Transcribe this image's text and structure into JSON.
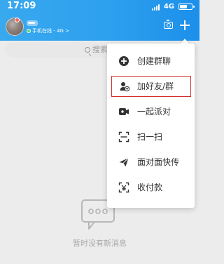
{
  "status_bar": {
    "time": "17:09",
    "network": "4G"
  },
  "header": {
    "online_status": "手机在线 - 4G >"
  },
  "search": {
    "placeholder": "搜索"
  },
  "menu": {
    "items": [
      {
        "label": "创建群聊",
        "icon": "group-chat-icon"
      },
      {
        "label": "加好友/群",
        "icon": "add-friend-icon"
      },
      {
        "label": "一起派对",
        "icon": "party-icon"
      },
      {
        "label": "扫一扫",
        "icon": "scan-icon"
      },
      {
        "label": "面对面快传",
        "icon": "send-icon"
      },
      {
        "label": "收付款",
        "icon": "payment-icon"
      }
    ]
  },
  "empty_state": {
    "message": "暂时没有新消息"
  },
  "colors": {
    "header_start": "#38a8ef",
    "header_end": "#1c8fea",
    "menu_highlight": "#d12d2d",
    "background": "#ececec"
  }
}
